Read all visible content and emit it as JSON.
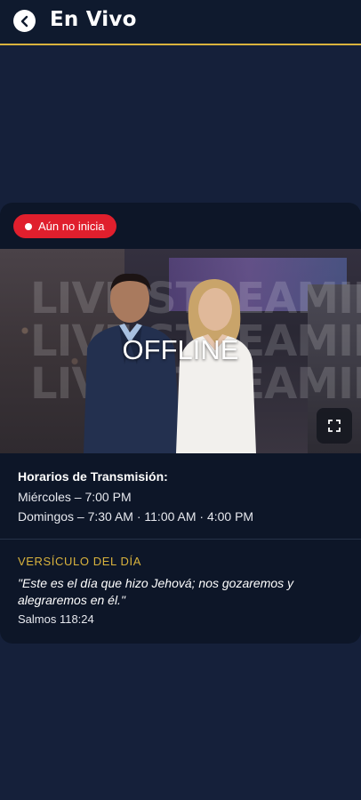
{
  "header": {
    "title": "En Vivo",
    "back_icon": "chevron-left-icon"
  },
  "colors": {
    "accent_gold": "#d9b33d",
    "badge_red": "#e01f2d",
    "background": "#15203a",
    "card": "#0d1628"
  },
  "stream": {
    "status_badge": "Aún no inicia",
    "overlay_text": "OFFLINE",
    "background_words": [
      "LIVE STREAMING",
      "LIVE STREAMING",
      "LIVE STREAMING"
    ],
    "fullscreen_icon": "fullscreen-icon"
  },
  "schedule": {
    "title": "Horarios de Transmisión:",
    "lines": [
      "Miércoles – 7:00 PM",
      "Domingos – 7:30 AM · 11:00 AM · 4:00 PM"
    ]
  },
  "verse": {
    "heading": "VERSÍCULO DEL DÍA",
    "text": "\"Este es el día que hizo Jehová; nos gozaremos y alegraremos en él.\"",
    "reference": "Salmos 118:24"
  }
}
